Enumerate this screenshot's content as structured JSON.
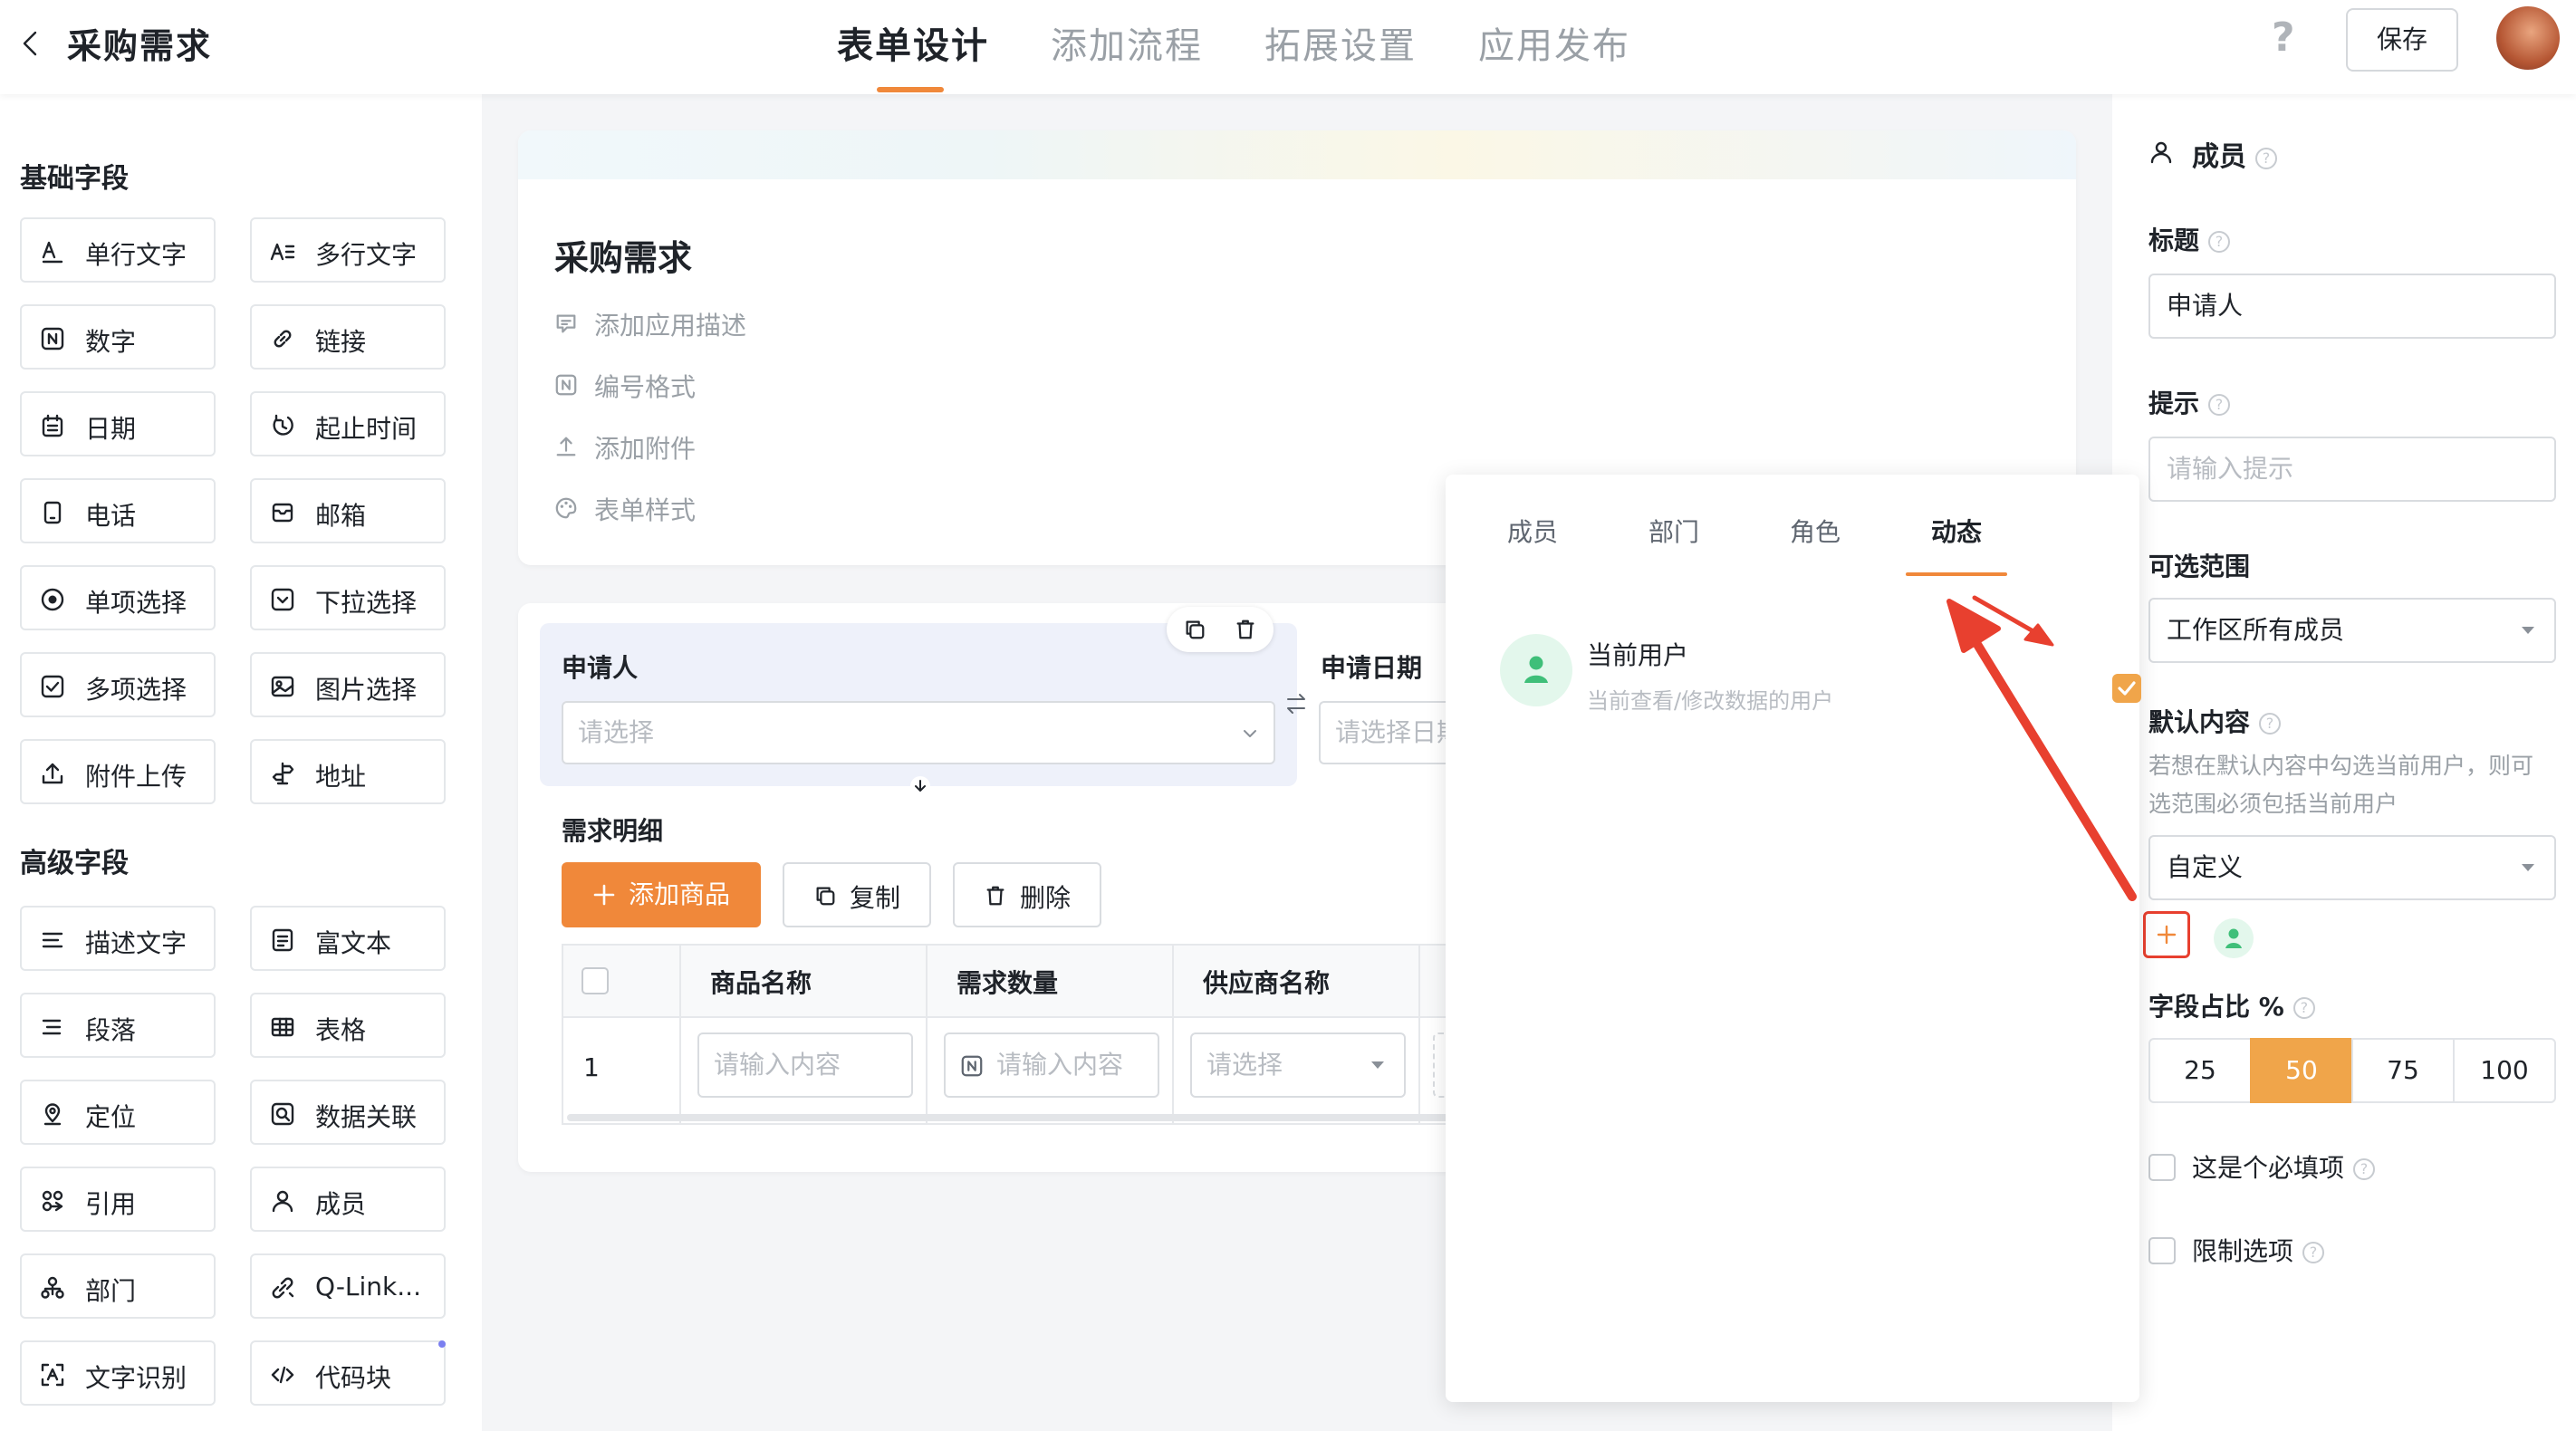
{
  "header": {
    "back_icon": "chevron-left-icon",
    "title": "采购需求",
    "tabs": [
      {
        "label": "表单设计",
        "active": true
      },
      {
        "label": "添加流程",
        "active": false
      },
      {
        "label": "拓展设置",
        "active": false
      },
      {
        "label": "应用发布",
        "active": false
      }
    ],
    "help": "?",
    "save_label": "保存",
    "accent": "#f0883a"
  },
  "sidebar": {
    "basic_title": "基础字段",
    "basic_fields": [
      {
        "label": "单行文字",
        "icon": "single-line-text-icon"
      },
      {
        "label": "多行文字",
        "icon": "multi-line-text-icon"
      },
      {
        "label": "数字",
        "icon": "number-icon"
      },
      {
        "label": "链接",
        "icon": "link-icon"
      },
      {
        "label": "日期",
        "icon": "calendar-icon"
      },
      {
        "label": "起止时间",
        "icon": "time-range-icon"
      },
      {
        "label": "电话",
        "icon": "phone-icon"
      },
      {
        "label": "邮箱",
        "icon": "mail-icon"
      },
      {
        "label": "单项选择",
        "icon": "radio-icon"
      },
      {
        "label": "下拉选择",
        "icon": "dropdown-icon"
      },
      {
        "label": "多项选择",
        "icon": "checkbox-icon"
      },
      {
        "label": "图片选择",
        "icon": "image-icon"
      },
      {
        "label": "附件上传",
        "icon": "upload-icon"
      },
      {
        "label": "地址",
        "icon": "signpost-icon"
      }
    ],
    "advanced_title": "高级字段",
    "advanced_fields": [
      {
        "label": "描述文字",
        "icon": "description-icon"
      },
      {
        "label": "富文本",
        "icon": "rich-text-icon"
      },
      {
        "label": "段落",
        "icon": "paragraph-icon"
      },
      {
        "label": "表格",
        "icon": "table-icon"
      },
      {
        "label": "定位",
        "icon": "location-icon"
      },
      {
        "label": "数据关联",
        "icon": "data-link-icon"
      },
      {
        "label": "引用",
        "icon": "reference-icon"
      },
      {
        "label": "成员",
        "icon": "user-icon"
      },
      {
        "label": "部门",
        "icon": "department-icon"
      },
      {
        "label": "Q-Link...",
        "icon": "qlink-icon"
      },
      {
        "label": "文字识别",
        "icon": "ocr-icon"
      },
      {
        "label": "代码块",
        "icon": "code-icon"
      }
    ]
  },
  "form": {
    "title": "采购需求",
    "meta": [
      "添加应用描述",
      "编号格式",
      "添加附件",
      "表单样式"
    ],
    "applicant_label": "申请人",
    "applicant_placeholder": "请选择",
    "date_label": "申请日期",
    "date_placeholder": "请选择日期",
    "detail_label": "需求明细",
    "add_button": "添加商品",
    "copy_button": "复制",
    "delete_button": "删除",
    "table": {
      "columns": [
        "商品名称",
        "需求数量",
        "供应商名称"
      ],
      "row_index": "1",
      "cell_placeholders": [
        "请输入内容",
        "请输入内容",
        "请选择"
      ]
    }
  },
  "popup": {
    "tabs": [
      {
        "label": "成员",
        "active": false
      },
      {
        "label": "部门",
        "active": false
      },
      {
        "label": "角色",
        "active": false
      },
      {
        "label": "动态",
        "active": true
      }
    ],
    "item_title": "当前用户",
    "item_subtitle": "当前查看/修改数据的用户",
    "item_checked": true
  },
  "props": {
    "header": "成员",
    "title_label": "标题",
    "title_value": "申请人",
    "hint_label": "提示",
    "hint_placeholder": "请输入提示",
    "range_label": "可选范围",
    "range_value": "工作区所有成员",
    "default_label": "默认内容",
    "default_note_1": "若想在默认内容中勾选当前用户，则可",
    "default_note_2": "选范围必须包括当前用户",
    "default_value": "自定义",
    "ratio_label": "字段占比 %",
    "ratio_options": [
      "25",
      "50",
      "75",
      "100"
    ],
    "ratio_selected": "50",
    "required_label": "这是个必填项",
    "limit_label": "限制选项",
    "required_checked": false,
    "limit_checked": false
  },
  "colors": {
    "accent": "#f0883a",
    "annotation_red": "#e8402f",
    "avatar_green": "#3fbf79"
  }
}
